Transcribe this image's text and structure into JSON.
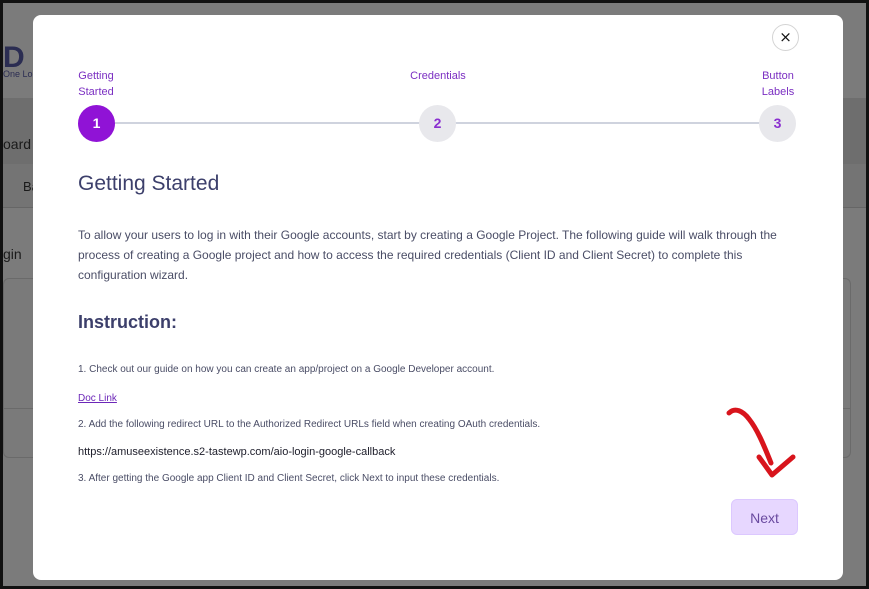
{
  "background": {
    "logo_text": "D L",
    "logo_sub": "One Lo",
    "tab_text": "oard",
    "sub_tab_text": "Ba",
    "section_text": "gin"
  },
  "modal": {
    "close_label": "×",
    "steps": [
      {
        "label_line1": "Getting",
        "label_line2": "Started",
        "number": "1",
        "active": true
      },
      {
        "label_line1": "Credentials",
        "label_line2": "",
        "number": "2",
        "active": false
      },
      {
        "label_line1": "Button",
        "label_line2": "Labels",
        "number": "3",
        "active": false
      }
    ],
    "title": "Getting Started",
    "intro": "To allow your users to log in with their Google accounts, start by creating a Google Project. The following guide will walk through the process of creating a Google project and how to access the required credentials (Client ID and Client Secret) to complete this configuration wizard.",
    "instruction_title": "Instruction:",
    "step1": "1. Check out our guide on how you can create an app/project on a Google Developer account.",
    "doc_link": "Doc Link",
    "step2": "2. Add the following redirect URL to the Authorized Redirect URLs field when creating OAuth credentials.",
    "redirect_url": "https://amuseexistence.s2-tastewp.com/aio-login-google-callback",
    "step3": "3. After getting the Google app Client ID and Client Secret, click Next to input these credentials.",
    "next_label": "Next"
  },
  "colors": {
    "accent": "#9013d6",
    "step_text": "#7b2fc2",
    "next_bg": "#e7d7ff",
    "annotation_arrow": "#d8141c"
  }
}
